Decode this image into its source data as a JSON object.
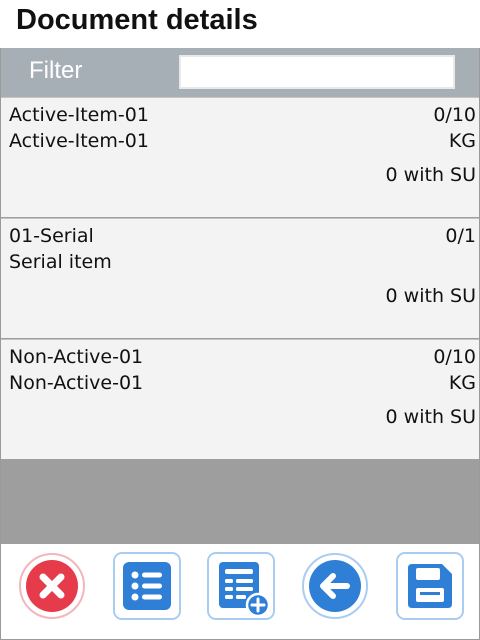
{
  "header": {
    "title": "Document details"
  },
  "filter": {
    "label": "Filter",
    "value": "",
    "placeholder": ""
  },
  "items": [
    {
      "code": "Active-Item-01",
      "description": "Active-Item-01",
      "quantity": "0/10",
      "unit": "KG",
      "su": "0 with SU"
    },
    {
      "code": "01-Serial",
      "description": "Serial item",
      "quantity": "0/1",
      "unit": "",
      "su": "0 with SU"
    },
    {
      "code": "Non-Active-01",
      "description": "Non-Active-01",
      "quantity": "0/10",
      "unit": "KG",
      "su": "0 with SU"
    }
  ],
  "toolbar": {
    "buttons": [
      {
        "name": "cancel-button",
        "icon": "close-icon"
      },
      {
        "name": "list-button",
        "icon": "list-icon"
      },
      {
        "name": "add-document-button",
        "icon": "document-add-icon"
      },
      {
        "name": "back-button",
        "icon": "arrow-left-icon"
      },
      {
        "name": "save-button",
        "icon": "floppy-disk-icon"
      }
    ]
  },
  "colors": {
    "accent_blue": "#2f7fd6",
    "cancel_red": "#e53b4a",
    "filter_bar": "#a7afb6",
    "list_background": "#9e9e9e"
  }
}
